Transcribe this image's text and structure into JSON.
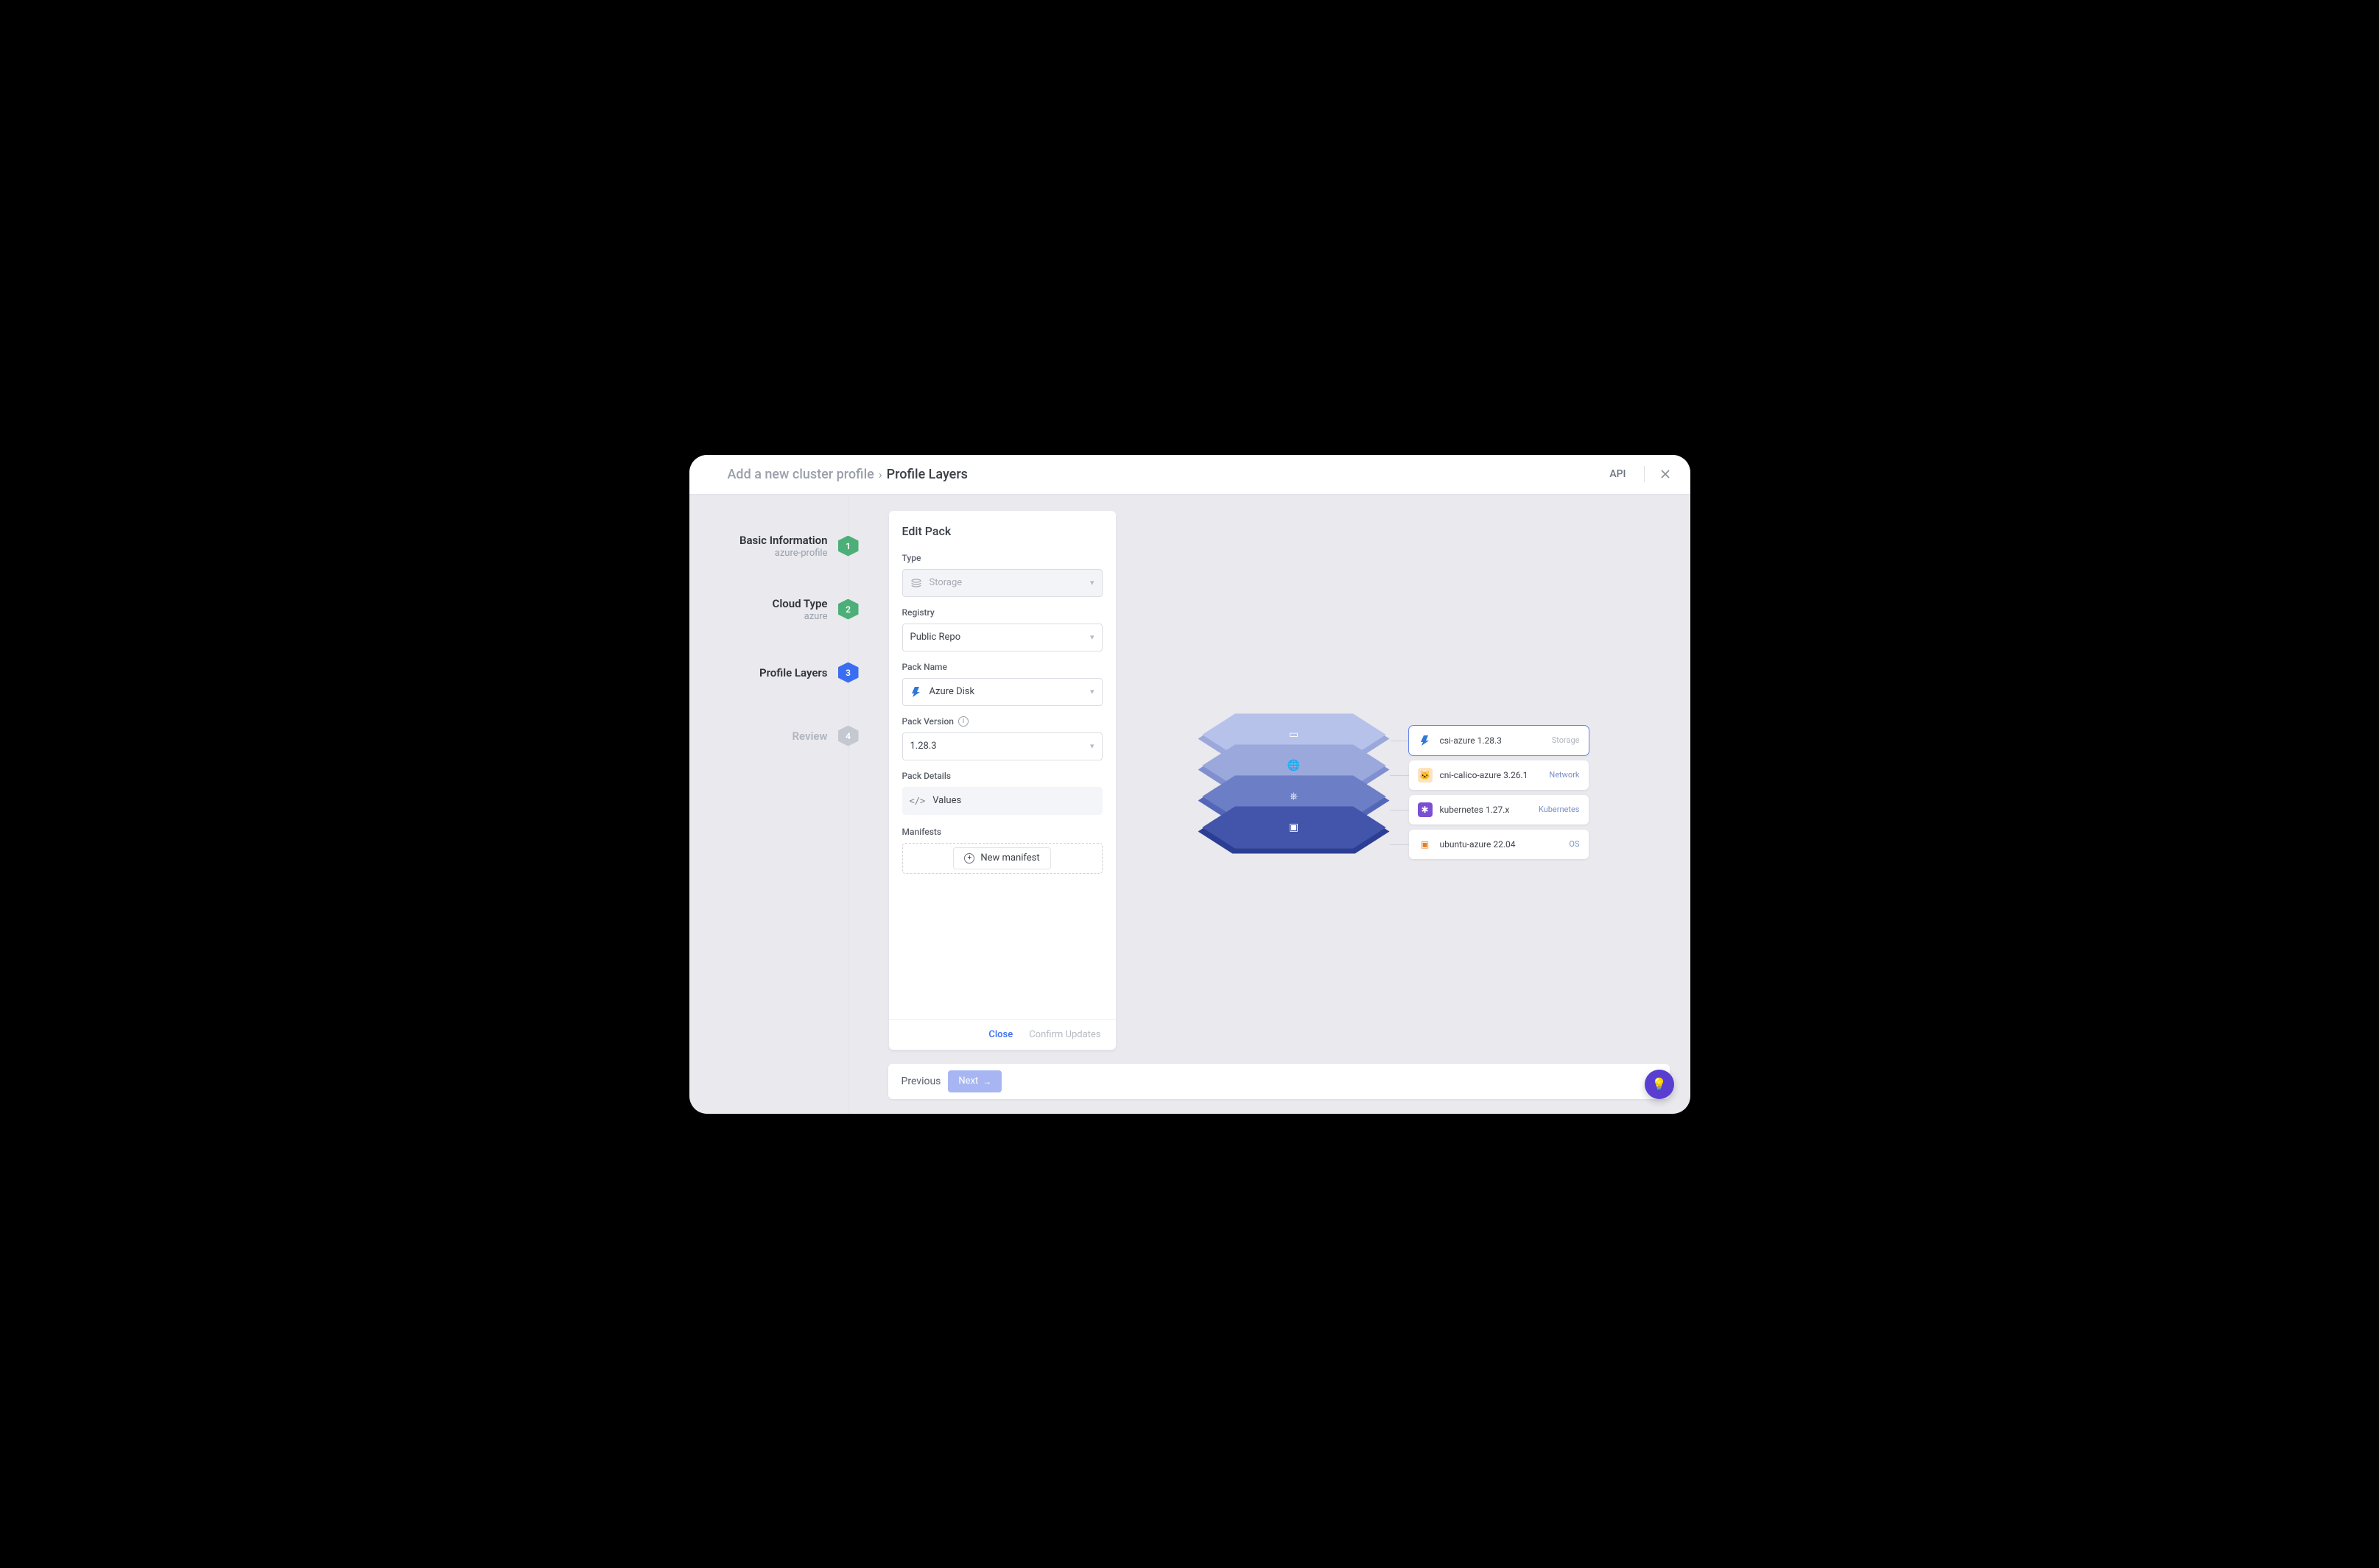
{
  "header": {
    "breadcrumb_root": "Add a new cluster profile",
    "breadcrumb_leaf": "Profile Layers",
    "api_label": "API"
  },
  "steps": [
    {
      "title": "Basic Information",
      "subtitle": "azure-profile",
      "num": "1",
      "state": "done"
    },
    {
      "title": "Cloud Type",
      "subtitle": "azure",
      "num": "2",
      "state": "done"
    },
    {
      "title": "Profile Layers",
      "subtitle": "",
      "num": "3",
      "state": "active"
    },
    {
      "title": "Review",
      "subtitle": "",
      "num": "4",
      "state": "pending"
    }
  ],
  "panel": {
    "title": "Edit Pack",
    "fields": {
      "type_label": "Type",
      "type_value": "Storage",
      "registry_label": "Registry",
      "registry_value": "Public Repo",
      "name_label": "Pack Name",
      "name_value": "Azure Disk",
      "version_label": "Pack Version",
      "version_value": "1.28.3",
      "details_label": "Pack Details",
      "values_label": "Values",
      "manifests_label": "Manifests",
      "new_manifest_label": "New manifest"
    },
    "close_label": "Close",
    "confirm_label": "Confirm Updates"
  },
  "layer_cards": [
    {
      "name": "csi-azure 1.28.3",
      "tag": "Storage",
      "icon": "azure",
      "selected": true
    },
    {
      "name": "cni-calico-azure 3.26.1",
      "tag": "Network",
      "icon": "calico",
      "selected": false
    },
    {
      "name": "kubernetes 1.27.x",
      "tag": "Kubernetes",
      "icon": "k8s",
      "selected": false
    },
    {
      "name": "ubuntu-azure 22.04",
      "tag": "OS",
      "icon": "ubuntu",
      "selected": false
    }
  ],
  "bottom": {
    "previous": "Previous",
    "next": "Next"
  }
}
